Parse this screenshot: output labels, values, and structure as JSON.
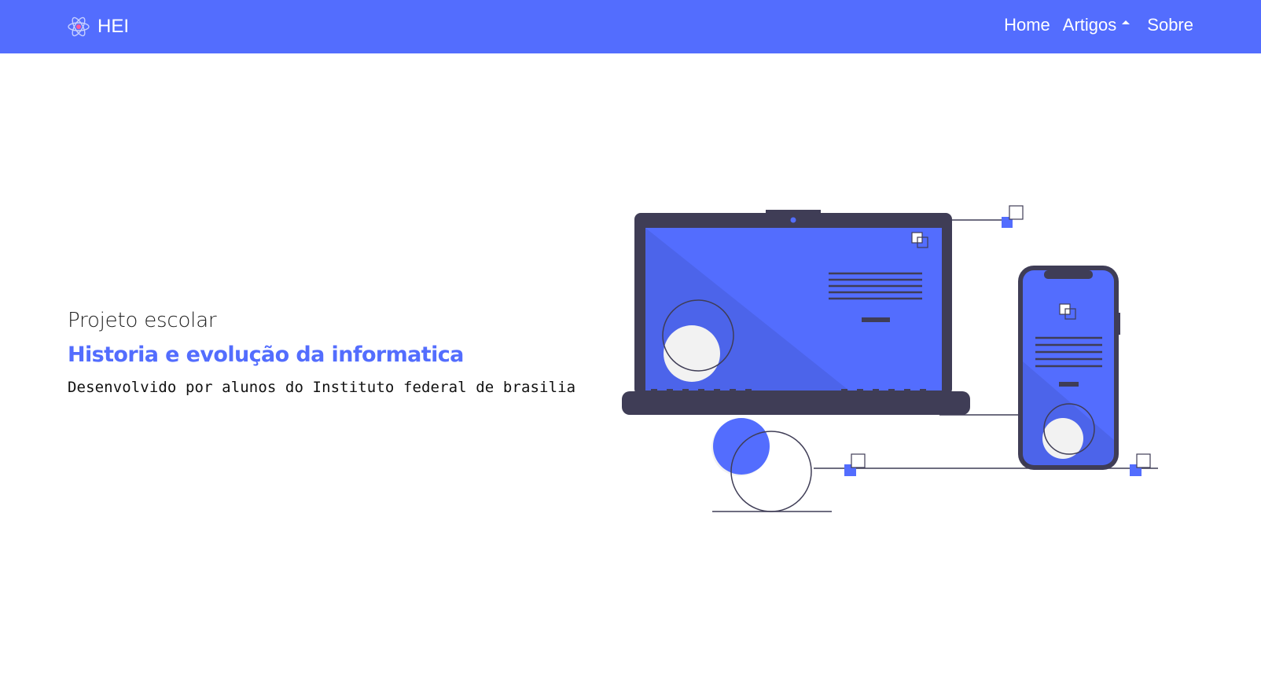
{
  "navbar": {
    "brand_text": "HEI",
    "brand_icon": "atom-icon",
    "links": {
      "home": "Home",
      "artigos": "Artigos",
      "sobre": "Sobre"
    },
    "background": "#536dfe"
  },
  "hero": {
    "eyebrow": "Projeto escolar",
    "title": "Historia e evolução da informatica",
    "subtitle": "Desenvolvido por alunos do Instituto federal de brasilia"
  },
  "illustration": {
    "subject": "devices-illustration",
    "accent": "#536dfe",
    "dark": "#3f3d56"
  }
}
